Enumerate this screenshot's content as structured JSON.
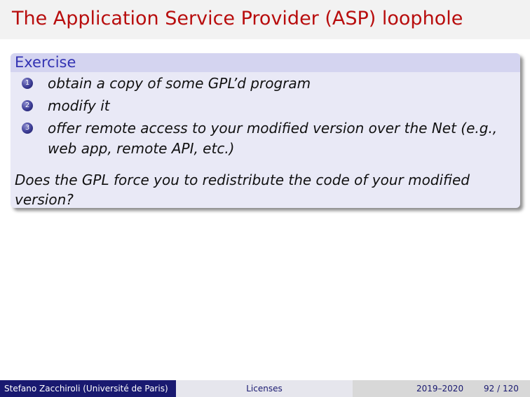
{
  "slide": {
    "title": "The Application Service Provider (ASP) loophole"
  },
  "block": {
    "title": "Exercise",
    "items": [
      {
        "number": "1",
        "text": "obtain a copy of some GPL’d program"
      },
      {
        "number": "2",
        "text": "modify it"
      },
      {
        "number": "3",
        "text": "offer remote access to your modified version over the Net (e.g., web app, remote API, etc.)"
      }
    ],
    "question": "Does the GPL force you to redistribute the code of your modified version?"
  },
  "footer": {
    "author": "Stefano Zacchiroli  (Université de Paris)",
    "section": "Licenses",
    "date": "2019–2020",
    "page": "92 / 120"
  },
  "colors": {
    "title": "#b80d0d",
    "block_title": "#3333b3",
    "footer_dark": "#191970"
  }
}
